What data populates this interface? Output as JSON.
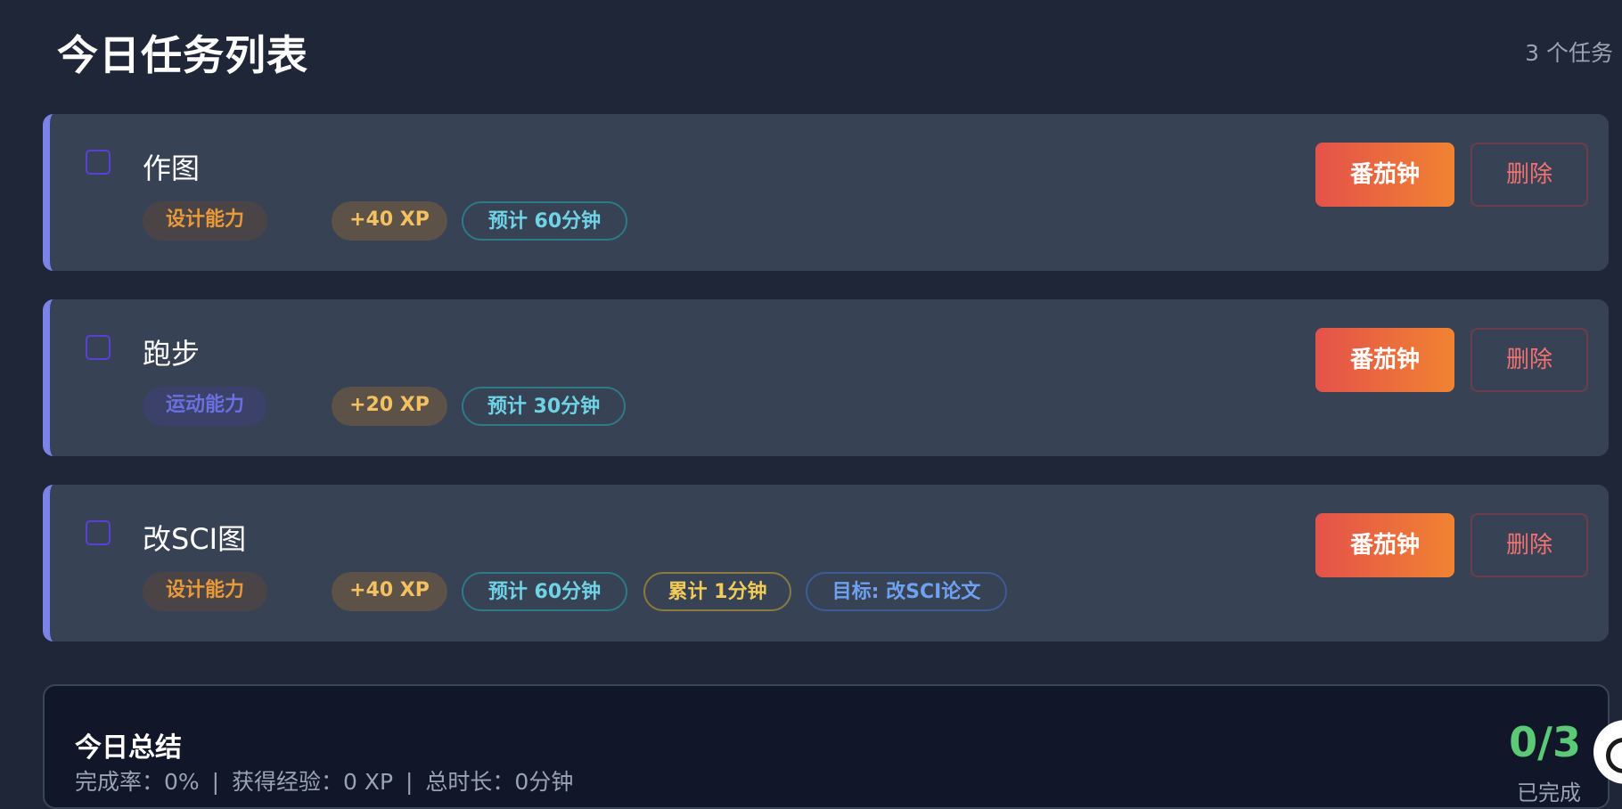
{
  "header": {
    "title": "今日任务列表",
    "task_count": "3 个任务"
  },
  "tasks": [
    {
      "title": "作图",
      "skill": "设计能力",
      "xp": "+40 XP",
      "estimate": "预计 60分钟",
      "pomodoro_label": "番茄钟",
      "delete_label": "删除"
    },
    {
      "title": "跑步",
      "skill": "运动能力",
      "xp": "+20 XP",
      "estimate": "预计 30分钟",
      "pomodoro_label": "番茄钟",
      "delete_label": "删除"
    },
    {
      "title": "改SCI图",
      "skill": "设计能力",
      "xp": "+40 XP",
      "estimate": "预计 60分钟",
      "accumulated": "累计 1分钟",
      "goal": "目标: 改SCI论文",
      "pomodoro_label": "番茄钟",
      "delete_label": "删除"
    }
  ],
  "summary": {
    "title": "今日总结",
    "completion_rate": "完成率：0%",
    "xp_gained": "获得经验：0 XP",
    "total_duration": "总时长：0分钟",
    "separator": "|",
    "ratio": "0/3",
    "done_label": "已完成"
  },
  "colors": {
    "accent_border": "#7b82e8",
    "pomodoro_gradient_start": "#e4524a",
    "pomodoro_gradient_end": "#f08332",
    "success": "#5cc977",
    "delete": "#f27272"
  },
  "icons": {
    "checkbox": "checkbox-icon",
    "avatar": "avatar-icon"
  }
}
